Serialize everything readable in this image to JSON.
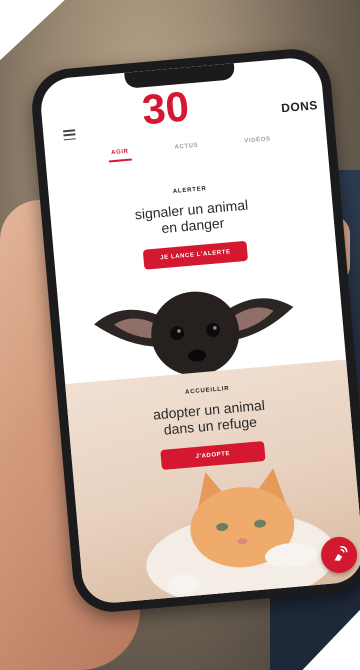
{
  "app": {
    "logo_text": "30",
    "donate_label": "DONS"
  },
  "tabs": [
    {
      "label": "AGIR",
      "active": true
    },
    {
      "label": "ACTUS",
      "active": false
    },
    {
      "label": "VIDÉOS",
      "active": false
    }
  ],
  "alert_section": {
    "kicker": "ALERTER",
    "headline_line1": "signaler un animal",
    "headline_line2": "en danger",
    "button_label": "JE LANCE L'ALERTE"
  },
  "adopt_section": {
    "kicker": "ACCUEILLIR",
    "headline_line1": "adopter un animal",
    "headline_line2": "dans un refuge",
    "button_label": "J'ADOPTE"
  },
  "colors": {
    "accent": "#d4182f",
    "text": "#2a2a2a",
    "inactive_tab": "#9d9d9d"
  },
  "icons": {
    "menu": "hamburger-icon",
    "fab": "signal-hand-icon"
  }
}
